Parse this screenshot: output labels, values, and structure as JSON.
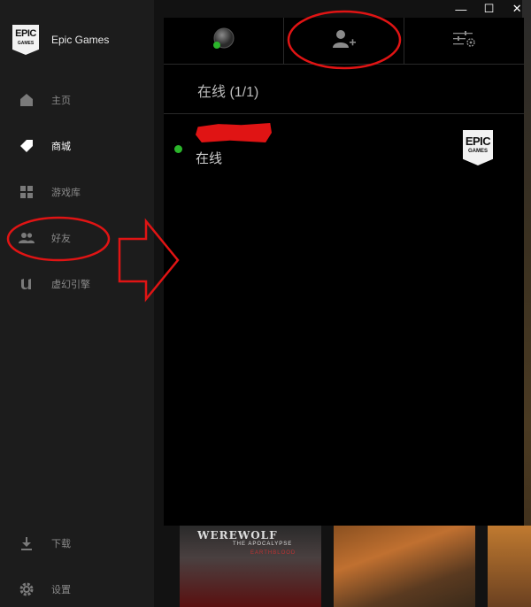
{
  "app": {
    "name": "Epic Games"
  },
  "sidebar": {
    "logo": {
      "line1": "EPIC",
      "line2": "GAMES"
    },
    "items": [
      {
        "label": "主页",
        "icon": "home-icon"
      },
      {
        "label": "商城",
        "icon": "tag-icon"
      },
      {
        "label": "游戏库",
        "icon": "grid-icon"
      },
      {
        "label": "好友",
        "icon": "people-icon"
      },
      {
        "label": "虚幻引擎",
        "icon": "unreal-icon"
      }
    ],
    "bottom_items": [
      {
        "label": "下载",
        "icon": "download-icon"
      },
      {
        "label": "设置",
        "icon": "gear-icon"
      }
    ]
  },
  "window_controls": {
    "minimize": "—",
    "maximize": "☐",
    "close": "✕"
  },
  "friends_panel": {
    "toolbar": [
      {
        "name": "status",
        "icon": "status-avatar-icon"
      },
      {
        "name": "add-friend",
        "icon": "add-friend-icon"
      },
      {
        "name": "settings",
        "icon": "sliders-gear-icon"
      }
    ],
    "online_header": "在线 (1/1)",
    "friends": [
      {
        "status": "在线",
        "status_color": "#2bb52b",
        "game_logo": {
          "line1": "EPIC",
          "line2": "GAMES"
        }
      }
    ]
  },
  "background_art": [
    {
      "title": "WEREWOLF",
      "subtitle": "THE APOCALYPSE",
      "subtitle2": "EARTHBLOOD"
    }
  ],
  "colors": {
    "accent_online": "#2bb52b",
    "annotation_red": "#e01414"
  }
}
